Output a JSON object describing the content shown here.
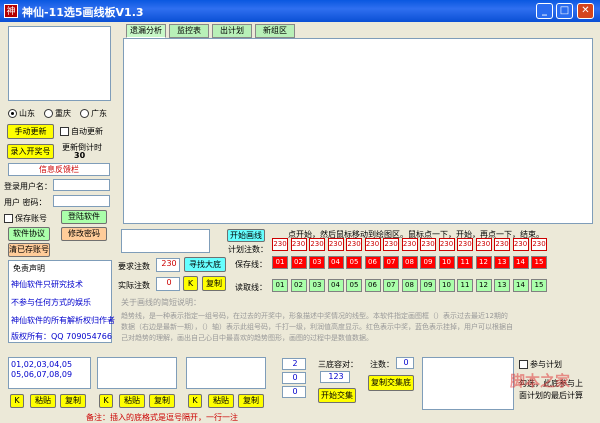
{
  "window": {
    "title": "神仙-11选5画线板V1.3",
    "app_icon": "神"
  },
  "tabs": [
    "遗漏分析",
    "监控表",
    "出计划",
    "新组区"
  ],
  "provinces": [
    "山东",
    "重庆",
    "广东"
  ],
  "left": {
    "manual_update": "手动更新",
    "auto_update": "自动更新",
    "enter_number": "录入开奖号",
    "countdown_label": "更新倒计时",
    "countdown_value": "30",
    "feedback": "信息反馈栏",
    "login_user_label": "登录用户名：",
    "password_label": "用户 密码：",
    "save_account": "保存账号",
    "login_button": "登陆软件",
    "software_agreement": "软件协议",
    "change_password": "修改密码",
    "clear_account": "清已存账号",
    "disclaimer_title": "免责声明",
    "disclaimer_lines": [
      "神仙软件只研究技术",
      "不参与任何方式的娱乐",
      "神仙软件的所有解析权归作者",
      "版权所有：QQ 709054766"
    ]
  },
  "graph": {
    "start_button": "开始画线",
    "hint": "点开始，然后鼠标移动到绘图区。鼠标点一下，开始，再点一下，结束。",
    "plan_count_label": "计划注数：",
    "keep_label": "保存线：",
    "read_label": "读取线：",
    "counts": [
      "230",
      "230",
      "230",
      "230",
      "230",
      "230",
      "230",
      "230",
      "230",
      "230",
      "230",
      "230",
      "230",
      "230",
      "230"
    ],
    "red_numbers": [
      "01",
      "02",
      "03",
      "04",
      "05",
      "06",
      "07",
      "08",
      "09",
      "10",
      "11",
      "12",
      "13",
      "14",
      "15"
    ],
    "green_numbers": [
      "01",
      "02",
      "03",
      "04",
      "05",
      "06",
      "07",
      "08",
      "09",
      "10",
      "11",
      "12",
      "13",
      "14",
      "15"
    ],
    "required_label": "要求注数",
    "required_value": "230",
    "find_button": "寻找大底",
    "actual_label": "实际注数",
    "actual_value": "0",
    "k_label": "K",
    "copy_label": "复制",
    "desc_title": "关于画线的简短说明：",
    "desc_lines": [
      "趋势线，是一种表示指定一组号码，在过去的开奖中，形象描述中奖情况的线型。本软件指定画图框（）表示过去最近12期的",
      "数据（右边是最新一期），（）轴）表示此组号码，千打一级，利润值高度显示。红色表示中奖，蓝色表示挂掉，用户可以根据自",
      "己对趋势的理解，画出自己心目中最喜欢的趋势图形，画图的过程中是数值数据。"
    ]
  },
  "bottom": {
    "box1_lines": [
      "01,02,03,04,05",
      "05,06,07,08,09"
    ],
    "k": "K",
    "paste": "粘贴",
    "copy": "复制",
    "num_boxes": [
      "2",
      "0",
      "0"
    ],
    "tri_label": "三底容对：",
    "tri_value": "123",
    "start_cross": "开始交集",
    "note_count_label": "注数：",
    "note_count_value": "0",
    "copy_cross": "复制交集底",
    "join_plan": "参与计划",
    "note": "备注：插入的底格式是逗号隔开，一行一注",
    "right_text1": "勾选，此底参与上",
    "right_text2": "面计划的最后计算"
  },
  "watermark": "脚本之家"
}
